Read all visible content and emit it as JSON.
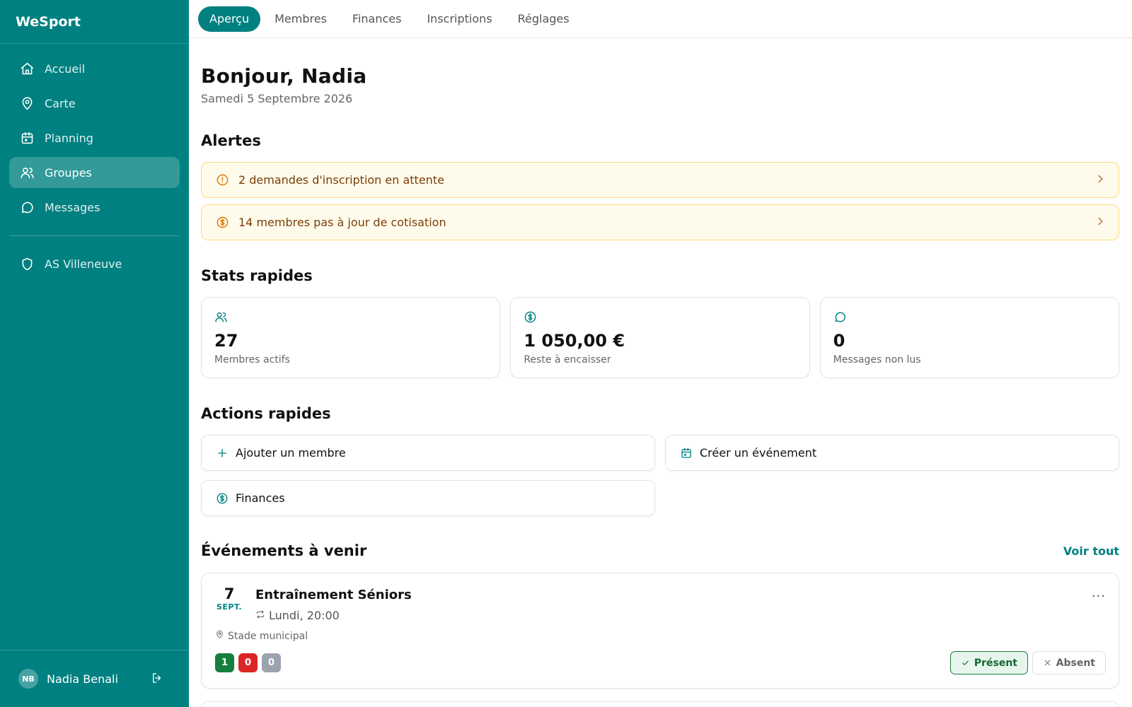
{
  "app": {
    "name": "WeSport"
  },
  "colors": {
    "brand": "#008080",
    "alert_bg": "#fffbeb",
    "alert_border": "#fcd97a",
    "present": "#166534"
  },
  "sidebar": {
    "items": [
      {
        "label": "Accueil",
        "icon": "home-icon"
      },
      {
        "label": "Carte",
        "icon": "map-pin-icon"
      },
      {
        "label": "Planning",
        "icon": "calendar-icon"
      },
      {
        "label": "Groupes",
        "icon": "users-icon",
        "active": true
      },
      {
        "label": "Messages",
        "icon": "message-icon"
      }
    ],
    "club": {
      "label": "AS Villeneuve",
      "icon": "shield-icon"
    },
    "user": {
      "initials": "NB",
      "name": "Nadia Benali"
    }
  },
  "tabs": [
    {
      "label": "Aperçu",
      "active": true
    },
    {
      "label": "Membres"
    },
    {
      "label": "Finances"
    },
    {
      "label": "Inscriptions"
    },
    {
      "label": "Réglages"
    }
  ],
  "header": {
    "greeting": "Bonjour, Nadia",
    "date": "Samedi 5 Septembre 2026"
  },
  "alerts": {
    "title": "Alertes",
    "items": [
      {
        "label": "2 demandes d'inscription en attente",
        "icon": "alert-circle-icon"
      },
      {
        "label": "14 membres pas à jour de cotisation",
        "icon": "dollar-circle-icon"
      }
    ]
  },
  "stats": {
    "title": "Stats rapides",
    "items": [
      {
        "value": "27",
        "label": "Membres actifs",
        "icon": "users-icon"
      },
      {
        "value": "1 050,00 €",
        "label": "Reste à encaisser",
        "icon": "dollar-circle-icon"
      },
      {
        "value": "0",
        "label": "Messages non lus",
        "icon": "message-icon"
      }
    ]
  },
  "actions": {
    "title": "Actions rapides",
    "items": [
      {
        "label": "Ajouter un membre",
        "icon": "plus-icon"
      },
      {
        "label": "Créer un événement",
        "icon": "calendar-icon"
      },
      {
        "label": "Finances",
        "icon": "dollar-circle-icon"
      }
    ]
  },
  "events": {
    "title": "Événements à venir",
    "see_all": "Voir tout",
    "items": [
      {
        "day": "7",
        "month": "SEPT.",
        "title": "Entraînement Séniors",
        "time": "Lundi, 20:00",
        "location": "Stade municipal",
        "more": "···",
        "counts": [
          {
            "value": "1",
            "color": "#15803d"
          },
          {
            "value": "0",
            "color": "#dc2626"
          },
          {
            "value": "0",
            "color": "#9ca3af"
          }
        ],
        "present_label": "Présent",
        "absent_label": "Absent"
      }
    ]
  }
}
